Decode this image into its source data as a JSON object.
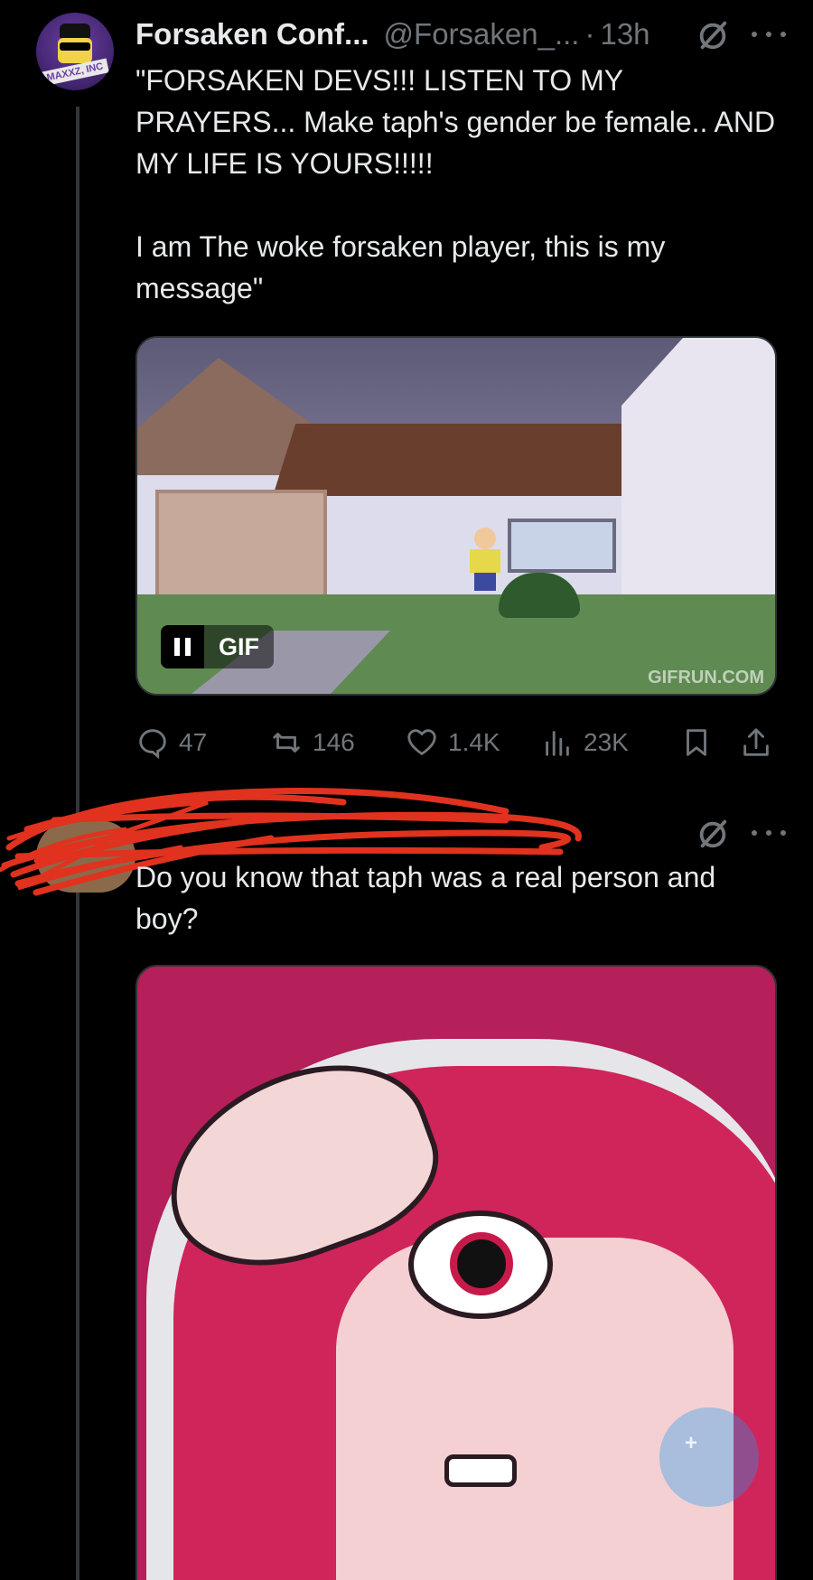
{
  "tweet1": {
    "display_name": "Forsaken Conf...",
    "handle": "@Forsaken_...",
    "separator": "·",
    "time": "13h",
    "avatar_text": "MAXXZ, INC",
    "text": "\"FORSAKEN DEVS!!! LISTEN TO MY PRAYERS... Make taph's gender be female.. AND MY LIFE IS YOURS!!!!!\n\nI am The woke forsaken player, this is my message\"",
    "media": {
      "badge_label": "GIF",
      "watermark": "GIFRUN.COM"
    },
    "actions": {
      "replies": "47",
      "reposts": "146",
      "likes": "1.4K",
      "views": "23K"
    }
  },
  "tweet2": {
    "text": "Do you know that taph was a real person and boy?"
  },
  "colors": {
    "background": "#000000",
    "text_primary": "#e7e9ea",
    "text_secondary": "#71767b",
    "redaction": "#e0321e",
    "accent": "#1d9bf0"
  },
  "icons": [
    "grok-icon",
    "more-icon",
    "reply-icon",
    "repost-icon",
    "like-icon",
    "views-icon",
    "bookmark-icon",
    "share-icon",
    "pause-icon",
    "compose-icon"
  ]
}
